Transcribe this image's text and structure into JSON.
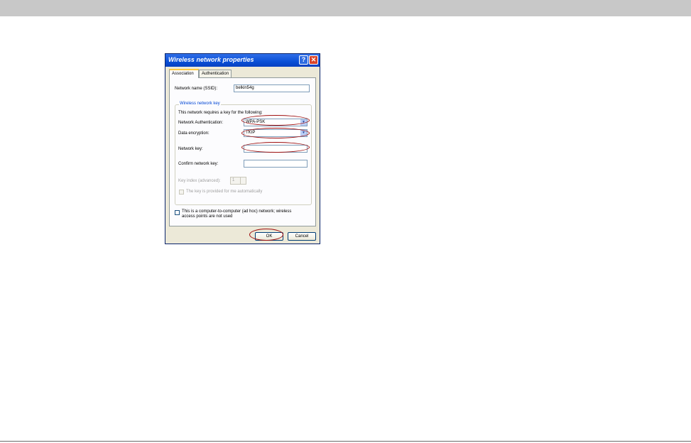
{
  "dialog": {
    "title": "Wireless network properties",
    "help_button": "?",
    "close_button": "✕",
    "tabs": [
      {
        "label": "Association",
        "active": true
      },
      {
        "label": "Authentication",
        "active": false
      }
    ],
    "network_name_label": "Network name (SSID):",
    "network_name_value": "belkin54g",
    "group_title": "Wireless network key",
    "key_required_text": "This network requires a key for the following:",
    "auth_label": "Network Authentication:",
    "auth_value": "WPA-PSK",
    "encryption_label": "Data encryption:",
    "encryption_value": "TKIP",
    "network_key_label": "Network key:",
    "network_key_value": "",
    "confirm_key_label": "Confirm network key:",
    "confirm_key_value": "",
    "key_index_label": "Key index (advanced):",
    "key_index_value": "1",
    "auto_key_label": "The key is provided for me automatically",
    "adhoc_label_line1": "This is a computer-to-computer (ad hoc) network; wireless",
    "adhoc_label_line2": "access points are not used",
    "ok_label": "OK",
    "cancel_label": "Cancel",
    "dropdown_arrow": "▼"
  },
  "colors": {
    "highlight": "#a01010",
    "titlebar": "#0a4fd6",
    "top_bar": "#c8c8c8"
  }
}
